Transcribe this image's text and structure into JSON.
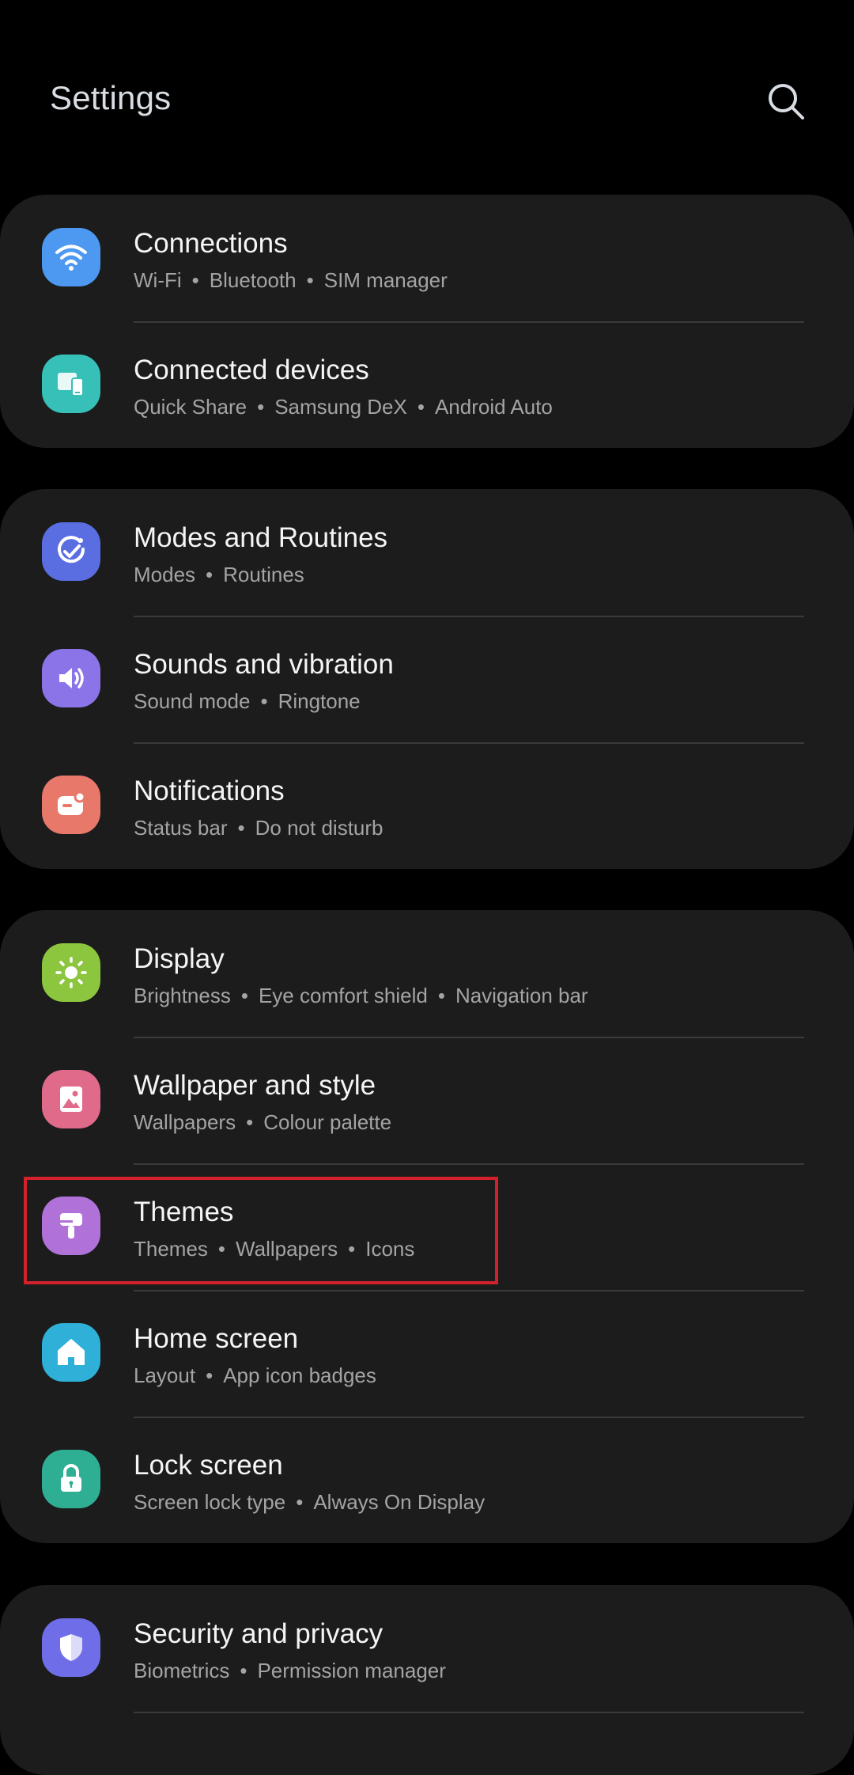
{
  "header": {
    "title": "Settings",
    "search_icon": "search-icon"
  },
  "groups": [
    {
      "items": [
        {
          "title": "Connections",
          "subtitle": [
            "Wi-Fi",
            "Bluetooth",
            "SIM manager"
          ],
          "icon": "wifi-icon",
          "icon_color": "#4d98f0"
        },
        {
          "title": "Connected devices",
          "subtitle": [
            "Quick Share",
            "Samsung DeX",
            "Android Auto"
          ],
          "icon": "connected-devices-icon",
          "icon_color": "#36c0b8"
        }
      ]
    },
    {
      "items": [
        {
          "title": "Modes and Routines",
          "subtitle": [
            "Modes",
            "Routines"
          ],
          "icon": "check-circle-icon",
          "icon_color": "#5a6ee2"
        },
        {
          "title": "Sounds and vibration",
          "subtitle": [
            "Sound mode",
            "Ringtone"
          ],
          "icon": "speaker-icon",
          "icon_color": "#8a74e8"
        },
        {
          "title": "Notifications",
          "subtitle": [
            "Status bar",
            "Do not disturb"
          ],
          "icon": "notification-icon",
          "icon_color": "#e8786a"
        }
      ]
    },
    {
      "items": [
        {
          "title": "Display",
          "subtitle": [
            "Brightness",
            "Eye comfort shield",
            "Navigation bar"
          ],
          "icon": "sun-icon",
          "icon_color": "#8cc63e"
        },
        {
          "title": "Wallpaper and style",
          "subtitle": [
            "Wallpapers",
            "Colour palette"
          ],
          "icon": "image-icon",
          "icon_color": "#e06a8a"
        },
        {
          "title": "Themes",
          "subtitle": [
            "Themes",
            "Wallpapers",
            "Icons"
          ],
          "icon": "paint-brush-icon",
          "icon_color": "#b071d8"
        },
        {
          "title": "Home screen",
          "subtitle": [
            "Layout",
            "App icon badges"
          ],
          "icon": "home-icon",
          "icon_color": "#2fb0d8"
        },
        {
          "title": "Lock screen",
          "subtitle": [
            "Screen lock type",
            "Always On Display"
          ],
          "icon": "lock-icon",
          "icon_color": "#2eaf94"
        }
      ]
    },
    {
      "items": [
        {
          "title": "Security and privacy",
          "subtitle": [
            "Biometrics",
            "Permission manager"
          ],
          "icon": "shield-icon",
          "icon_color": "#6f6ee8"
        }
      ]
    }
  ],
  "colors": {
    "background": "#000000",
    "card": "#1c1c1c",
    "divider": "#3a3a3a",
    "highlight": "#d2202c"
  }
}
